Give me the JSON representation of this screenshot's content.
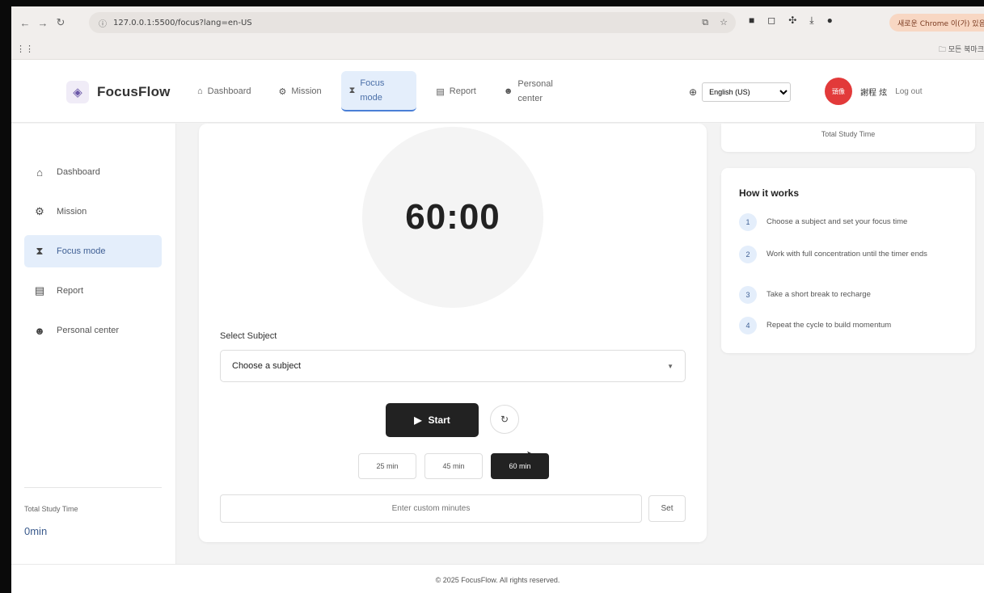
{
  "browser": {
    "url": "127.0.0.1:5500/focus?lang=en-US",
    "pill_text": "새로운 Chrome 이(가) 있음",
    "bookmark_folder": "모든 북마크"
  },
  "header": {
    "brand": "FocusFlow",
    "nav": [
      {
        "label": "Dashboard",
        "icon": "home-icon"
      },
      {
        "label": "Mission",
        "icon": "gear-icon"
      },
      {
        "label": "Focus mode",
        "icon": "hourglass-icon"
      },
      {
        "label": "Report",
        "icon": "report-icon"
      },
      {
        "label": "Personal center",
        "icon": "user-icon"
      }
    ],
    "language": "English (US)",
    "avatar_text": "頭像",
    "username": "謝程 炫",
    "logout": "Log out"
  },
  "sidebar": {
    "items": [
      {
        "label": "Dashboard",
        "icon": "home-icon"
      },
      {
        "label": "Mission",
        "icon": "gear-icon"
      },
      {
        "label": "Focus mode",
        "icon": "hourglass-icon"
      },
      {
        "label": "Report",
        "icon": "report-icon"
      },
      {
        "label": "Personal center",
        "icon": "user-icon"
      }
    ],
    "total_label": "Total Study Time",
    "total_value": "0min"
  },
  "timer": {
    "display": "60:00",
    "select_label": "Select Subject",
    "select_placeholder": "Choose a subject",
    "start_label": "Start",
    "presets": [
      "25 min",
      "45 min",
      "60 min"
    ],
    "custom_placeholder": "Enter custom minutes",
    "set_label": "Set"
  },
  "stats": {
    "total_label": "Total Study Time"
  },
  "how": {
    "title": "How it works",
    "steps": [
      {
        "num": "1",
        "text": "Choose a subject and set your focus time"
      },
      {
        "num": "2",
        "text": "Work with full concentration until the timer ends"
      },
      {
        "num": "3",
        "text": "Take a short break to recharge"
      },
      {
        "num": "4",
        "text": "Repeat the cycle to build momentum"
      }
    ]
  },
  "footer": {
    "text": "© 2025 FocusFlow. All rights reserved."
  },
  "colors": {
    "accent": "#4a7fd6",
    "active_bg": "#e4eefb",
    "primary_btn": "#222222",
    "avatar": "#e23a3a"
  }
}
